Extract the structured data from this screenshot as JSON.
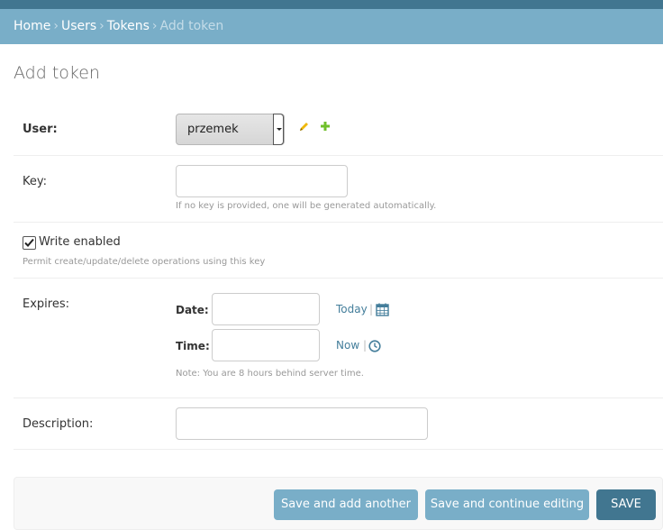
{
  "breadcrumbs": {
    "home": "Home",
    "users": "Users",
    "tokens": "Tokens",
    "current": "Add token",
    "separator": "›"
  },
  "page_title": "Add token",
  "form": {
    "user": {
      "label": "User:",
      "selected": "przemek"
    },
    "key": {
      "label": "Key:",
      "value": "",
      "help": "If no key is provided, one will be generated automatically."
    },
    "write_enabled": {
      "label": "Write enabled",
      "checked": true,
      "help": "Permit create/update/delete operations using this key"
    },
    "expires": {
      "label": "Expires:",
      "date_label": "Date:",
      "date_value": "",
      "today_link": "Today",
      "time_label": "Time:",
      "time_value": "",
      "now_link": "Now",
      "pipe": "|",
      "note": "Note: You are 8 hours behind server time."
    },
    "description": {
      "label": "Description:",
      "value": ""
    }
  },
  "actions": {
    "save_add_another": "Save and add another",
    "save_continue": "Save and continue editing",
    "save": "SAVE"
  },
  "colors": {
    "header": "#417690",
    "breadcrumbs_bg": "#79aec8",
    "link": "#447e9b",
    "button_light": "#79aec8",
    "button_dark": "#417690",
    "add_icon": "#70bf2b",
    "edit_icon": "#efb80b"
  }
}
